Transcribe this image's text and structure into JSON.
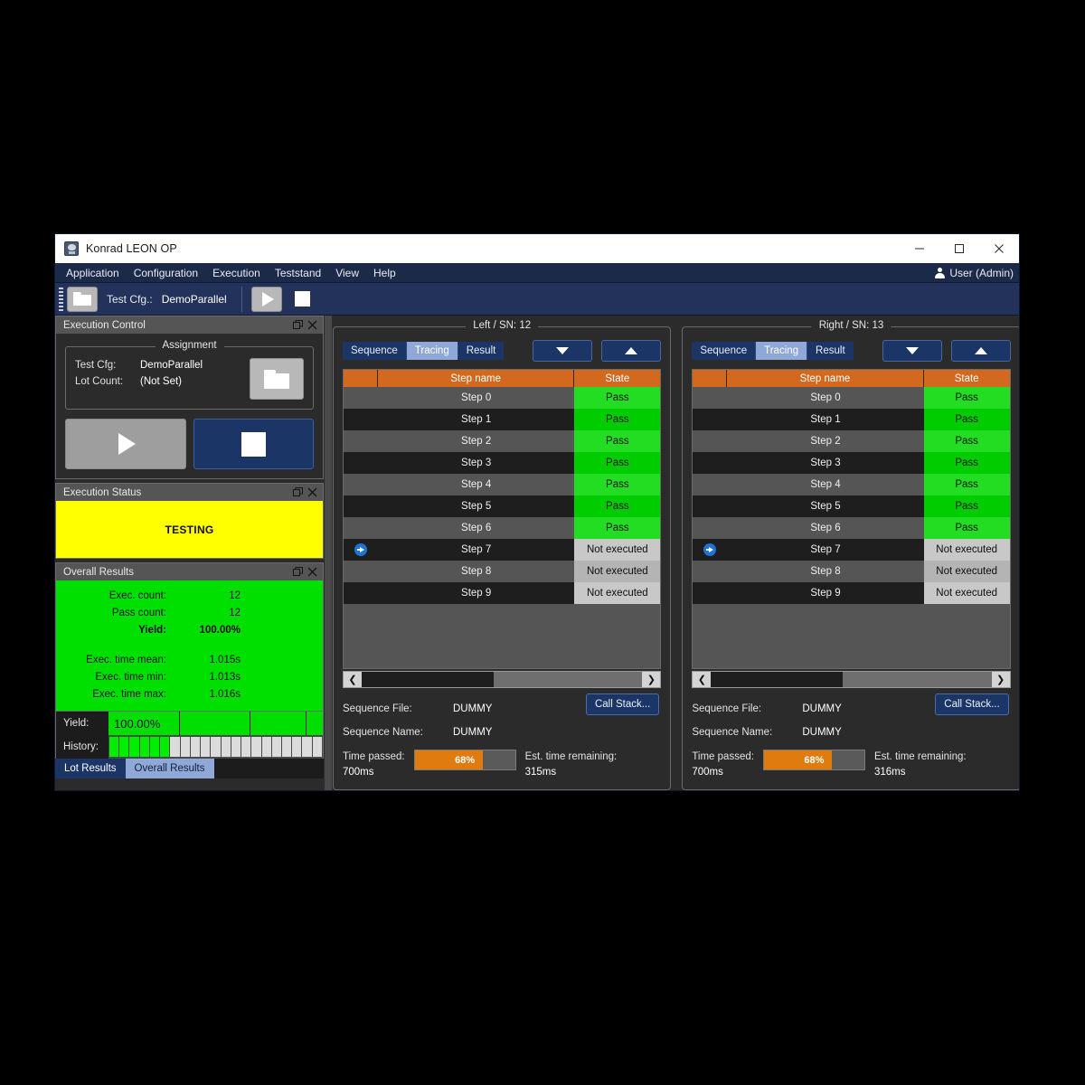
{
  "window": {
    "title": "Konrad LEON OP",
    "icon": "app-icon",
    "controls": {
      "minimize": "–",
      "maximize": "☐",
      "close": "✕"
    }
  },
  "menubar": {
    "items": [
      "Application",
      "Configuration",
      "Execution",
      "Teststand",
      "View",
      "Help"
    ],
    "user": "User (Admin)"
  },
  "toolbar": {
    "open_icon": "folder-open-icon",
    "test_cfg_label": "Test Cfg.:",
    "test_cfg_value": "DemoParallel",
    "run_icon": "play-icon",
    "stop_icon": "stop-icon"
  },
  "execution_control": {
    "title": "Execution Control",
    "group_title": "Assignment",
    "rows": [
      {
        "key": "Test Cfg:",
        "value": "DemoParallel"
      },
      {
        "key": "Lot Count:",
        "value": "(Not Set)"
      }
    ],
    "browse_icon": "folder-open-icon",
    "run_icon": "play-icon",
    "stop_icon": "stop-icon"
  },
  "execution_status": {
    "title": "Execution Status",
    "status": "TESTING",
    "status_color": "#ffff00"
  },
  "overall_results": {
    "title": "Overall Results",
    "background_color": "#00e000",
    "rows": [
      {
        "key": "Exec. count:",
        "value": "12",
        "bold": false
      },
      {
        "key": "Pass count:",
        "value": "12",
        "bold": false
      },
      {
        "key": "Yield:",
        "value": "100.00%",
        "bold": true
      }
    ],
    "time_rows": [
      {
        "key": "Exec. time mean:",
        "value": "1.015s"
      },
      {
        "key": "Exec. time min:",
        "value": "1.013s"
      },
      {
        "key": "Exec. time max:",
        "value": "1.016s"
      }
    ],
    "yield_label": "Yield:",
    "yield_value": "100.00%",
    "history_label": "History:",
    "history": [
      "pass",
      "pass",
      "pass",
      "pass",
      "pass",
      "pass",
      "empty",
      "empty",
      "empty",
      "empty",
      "empty",
      "empty",
      "empty",
      "empty",
      "empty",
      "empty",
      "empty",
      "empty",
      "empty",
      "empty",
      "empty"
    ]
  },
  "bottom_tabs": {
    "items": [
      {
        "label": "Lot Results",
        "active": false
      },
      {
        "label": "Overall Results",
        "active": true
      }
    ]
  },
  "stations": [
    {
      "title": "Left / SN: 12",
      "tabs": [
        {
          "label": "Sequence",
          "active": false
        },
        {
          "label": "Tracing",
          "active": true
        },
        {
          "label": "Result",
          "active": false
        }
      ],
      "nav": {
        "down_icon": "chevron-down-icon",
        "up_icon": "chevron-up-icon"
      },
      "columns": [
        "",
        "Step name",
        "State"
      ],
      "rows": [
        {
          "name": "Step 0",
          "state": "Pass",
          "current": false
        },
        {
          "name": "Step 1",
          "state": "Pass",
          "current": false
        },
        {
          "name": "Step 2",
          "state": "Pass",
          "current": false
        },
        {
          "name": "Step 3",
          "state": "Pass",
          "current": false
        },
        {
          "name": "Step 4",
          "state": "Pass",
          "current": false
        },
        {
          "name": "Step 5",
          "state": "Pass",
          "current": false
        },
        {
          "name": "Step 6",
          "state": "Pass",
          "current": false
        },
        {
          "name": "Step 7",
          "state": "Not executed",
          "current": true
        },
        {
          "name": "Step 8",
          "state": "Not executed",
          "current": false
        },
        {
          "name": "Step 9",
          "state": "Not executed",
          "current": false
        }
      ],
      "info": [
        {
          "key": "Sequence File:",
          "value": "DUMMY"
        },
        {
          "key": "Sequence Name:",
          "value": "DUMMY"
        }
      ],
      "call_stack_label": "Call Stack...",
      "time_passed_label": "Time passed:",
      "time_passed_value": "700ms",
      "progress_percent": "68%",
      "progress_value": 68,
      "est_remaining_label": "Est. time remaining:",
      "est_remaining_value": "315ms"
    },
    {
      "title": "Right / SN: 13",
      "tabs": [
        {
          "label": "Sequence",
          "active": false
        },
        {
          "label": "Tracing",
          "active": true
        },
        {
          "label": "Result",
          "active": false
        }
      ],
      "nav": {
        "down_icon": "chevron-down-icon",
        "up_icon": "chevron-up-icon"
      },
      "columns": [
        "",
        "Step name",
        "State"
      ],
      "rows": [
        {
          "name": "Step 0",
          "state": "Pass",
          "current": false
        },
        {
          "name": "Step 1",
          "state": "Pass",
          "current": false
        },
        {
          "name": "Step 2",
          "state": "Pass",
          "current": false
        },
        {
          "name": "Step 3",
          "state": "Pass",
          "current": false
        },
        {
          "name": "Step 4",
          "state": "Pass",
          "current": false
        },
        {
          "name": "Step 5",
          "state": "Pass",
          "current": false
        },
        {
          "name": "Step 6",
          "state": "Pass",
          "current": false
        },
        {
          "name": "Step 7",
          "state": "Not executed",
          "current": true
        },
        {
          "name": "Step 8",
          "state": "Not executed",
          "current": false
        },
        {
          "name": "Step 9",
          "state": "Not executed",
          "current": false
        }
      ],
      "info": [
        {
          "key": "Sequence File:",
          "value": "DUMMY"
        },
        {
          "key": "Sequence Name:",
          "value": "DUMMY"
        }
      ],
      "call_stack_label": "Call Stack...",
      "time_passed_label": "Time passed:",
      "time_passed_value": "700ms",
      "progress_percent": "68%",
      "progress_value": 68,
      "est_remaining_label": "Est. time remaining:",
      "est_remaining_value": "316ms"
    }
  ],
  "colors": {
    "accent_orange": "#d2691e",
    "pass_green": "#00e000",
    "testing_yellow": "#ffff00",
    "navy": "#1b3566",
    "panel_gray": "#2b2b2b"
  }
}
